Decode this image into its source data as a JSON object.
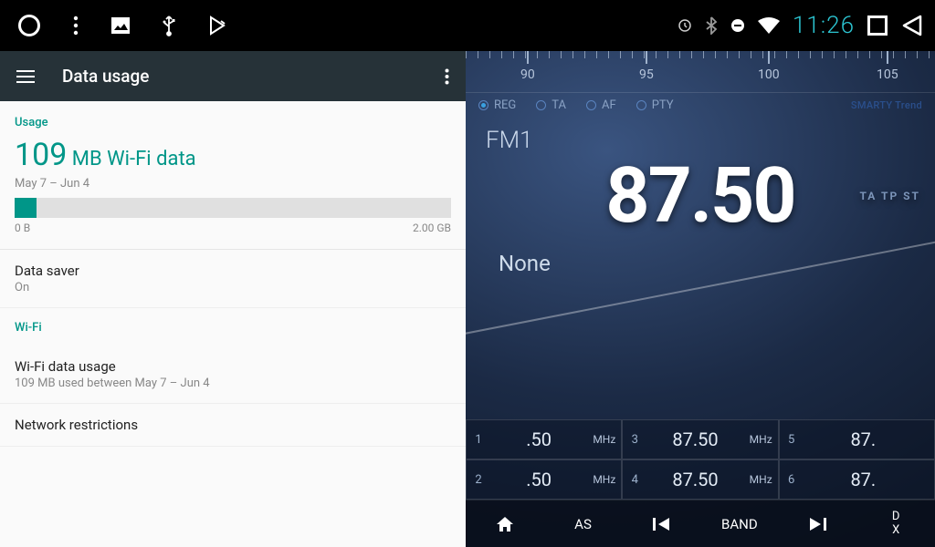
{
  "status": {
    "time": "11:26"
  },
  "settings": {
    "title": "Data usage",
    "usage_label": "Usage",
    "usage_value": "109",
    "usage_unit": "MB Wi-Fi data",
    "date_range": "May 7 – Jun 4",
    "bar_min": "0 B",
    "bar_max": "2.00 GB",
    "bar_percent": 5,
    "data_saver_title": "Data saver",
    "data_saver_sub": "On",
    "wifi_label": "Wi-Fi",
    "wifi_usage_title": "Wi-Fi data usage",
    "wifi_usage_sub": "109 MB used between May 7 – Jun 4",
    "network_restrictions": "Network restrictions"
  },
  "radio": {
    "dial_marks": [
      "90",
      "95",
      "100",
      "105"
    ],
    "opts": {
      "reg": "REG",
      "ta": "TA",
      "af": "AF",
      "pty": "PTY"
    },
    "brand": "SMARTY Trend",
    "band": "FM1",
    "freq": "87.50",
    "side_flags": "TA  TP  ST",
    "rds": "None",
    "presets": [
      {
        "num": "1",
        "freq": ".50",
        "unit": "MHz"
      },
      {
        "num": "3",
        "freq": "87.50",
        "unit": "MHz"
      },
      {
        "num": "5",
        "freq": "87.",
        "unit": ""
      },
      {
        "num": "2",
        "freq": ".50",
        "unit": "MHz"
      },
      {
        "num": "4",
        "freq": "87.50",
        "unit": "MHz"
      },
      {
        "num": "6",
        "freq": "87.",
        "unit": ""
      }
    ],
    "nav": {
      "as": "AS",
      "band": "BAND",
      "dx1": "D",
      "dx2": "X"
    }
  }
}
